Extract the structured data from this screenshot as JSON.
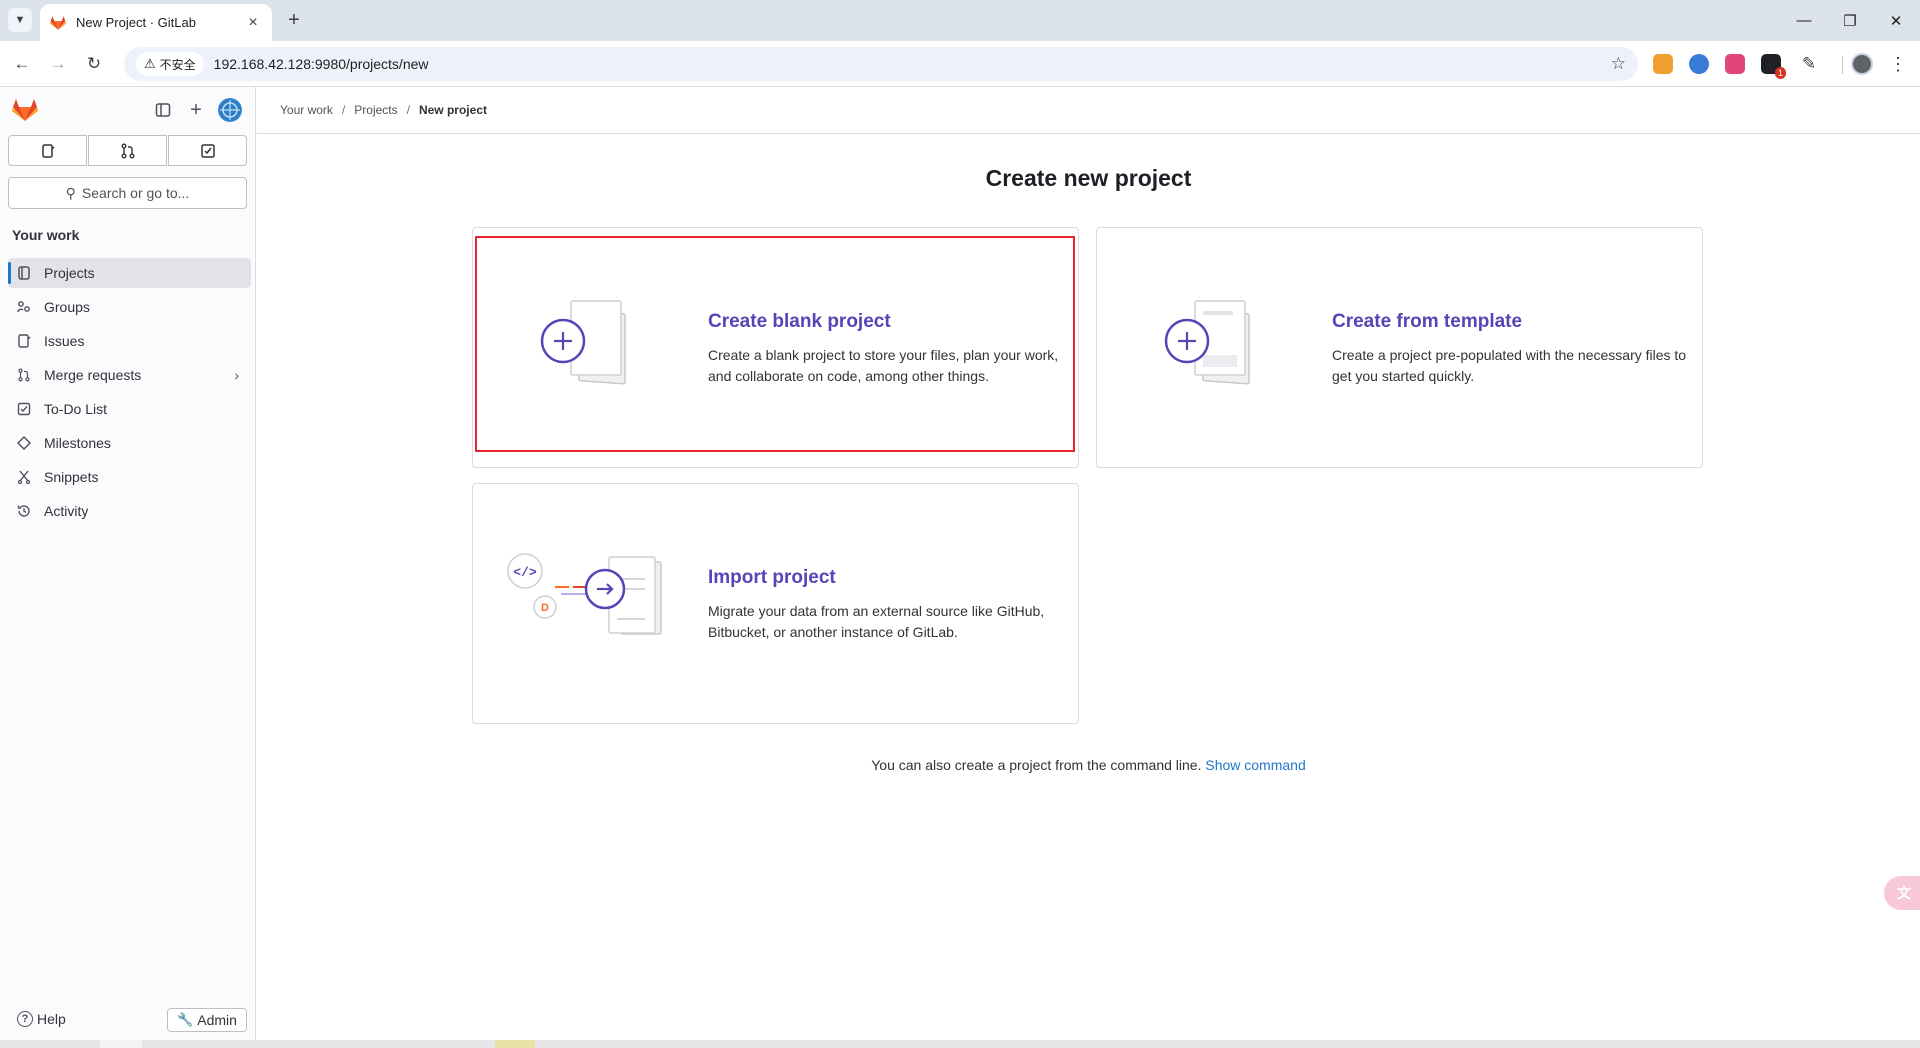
{
  "browser": {
    "tab_title": "New Project · GitLab",
    "insecure_label": "不安全",
    "url": "192.168.42.128:9980/projects/new",
    "extension_badge": "1"
  },
  "sidebar": {
    "search_placeholder": "Search or go to...",
    "section_title": "Your work",
    "items": [
      {
        "label": "Projects",
        "icon": "project-icon",
        "active": true
      },
      {
        "label": "Groups",
        "icon": "group-icon"
      },
      {
        "label": "Issues",
        "icon": "issues-icon"
      },
      {
        "label": "Merge requests",
        "icon": "merge-request-icon",
        "has_submenu": true
      },
      {
        "label": "To-Do List",
        "icon": "todo-icon"
      },
      {
        "label": "Milestones",
        "icon": "milestone-icon"
      },
      {
        "label": "Snippets",
        "icon": "snippet-icon"
      },
      {
        "label": "Activity",
        "icon": "history-icon"
      }
    ],
    "help_label": "Help",
    "admin_label": "Admin"
  },
  "breadcrumb": {
    "items": [
      "Your work",
      "Projects",
      "New project"
    ]
  },
  "main": {
    "title": "Create new project",
    "cards": [
      {
        "title": "Create blank project",
        "description": "Create a blank project to store your files, plan your work, and collaborate on code, among other things."
      },
      {
        "title": "Create from template",
        "description": "Create a project pre-populated with the necessary files to get you started quickly."
      },
      {
        "title": "Import project",
        "description": "Migrate your data from an external source like GitHub, Bitbucket, or another instance of GitLab."
      }
    ],
    "command_line_text": "You can also create a project from the command line.",
    "show_command_label": "Show command"
  },
  "colors": {
    "accent": "#5943b6",
    "link": "#1f75cb",
    "highlight": "#e5262b"
  }
}
